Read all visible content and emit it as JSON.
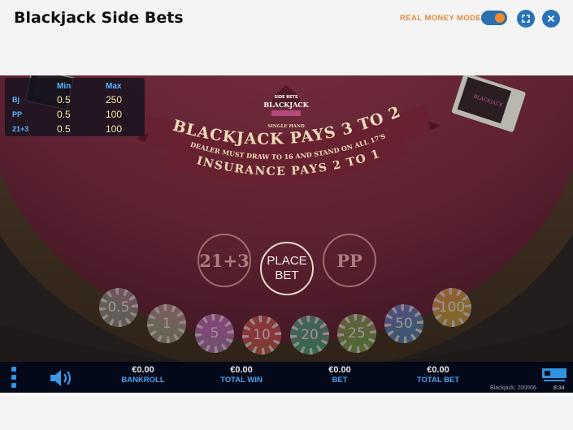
{
  "header": {
    "title": "Blackjack Side Bets",
    "mode_label": "REAL MONEY MODE",
    "mode_on": true,
    "expand_icon": "expand-icon",
    "close_icon": "close-icon"
  },
  "limits": {
    "min_label": "Min",
    "max_label": "Max",
    "rows": [
      {
        "name": "Bj",
        "min": "0.5",
        "max": "250"
      },
      {
        "name": "PP",
        "min": "0.5",
        "max": "100"
      },
      {
        "name": "21+3",
        "min": "0.5",
        "max": "100"
      }
    ]
  },
  "table": {
    "logo_top": "SIDE BETS",
    "logo_main": "BLACKJACK",
    "logo_sub": "SINGLE HAND",
    "arc_main": "BLACKJACK PAYS 3 TO 2",
    "arc_dealer": "DEALER MUST DRAW TO 16 AND STAND ON ALL 17'S",
    "arc_insurance": "INSURANCE PAYS 2 TO 1"
  },
  "bets": {
    "left": "21+3",
    "center_line1": "PLACE",
    "center_line2": "BET",
    "right": "PP"
  },
  "chips": [
    {
      "value": "0.5",
      "color": "#8a8a8a"
    },
    {
      "value": "1",
      "color": "#9a9a8a"
    },
    {
      "value": "5",
      "color": "#b070b8"
    },
    {
      "value": "10",
      "color": "#c0504a"
    },
    {
      "value": "20",
      "color": "#3aa07a"
    },
    {
      "value": "25",
      "color": "#6ca04a"
    },
    {
      "value": "50",
      "color": "#4a80c0"
    },
    {
      "value": "100",
      "color": "#c89a3a"
    }
  ],
  "bottom": {
    "bankroll_value": "€0.00",
    "bankroll_label": "BANKROLL",
    "totalwin_value": "€0.00",
    "totalwin_label": "TOTAL WIN",
    "bet_value": "€0.00",
    "bet_label": "BET",
    "totalbet_value": "€0.00",
    "totalbet_label": "TOTAL BET",
    "game_id": "Blackjack: 200006",
    "time": "8:34"
  },
  "colors": {
    "felt": "#6e2a3a",
    "accent": "#2a72b8",
    "mode_label": "#e08a3c",
    "label_blue": "#4aa2f0"
  }
}
